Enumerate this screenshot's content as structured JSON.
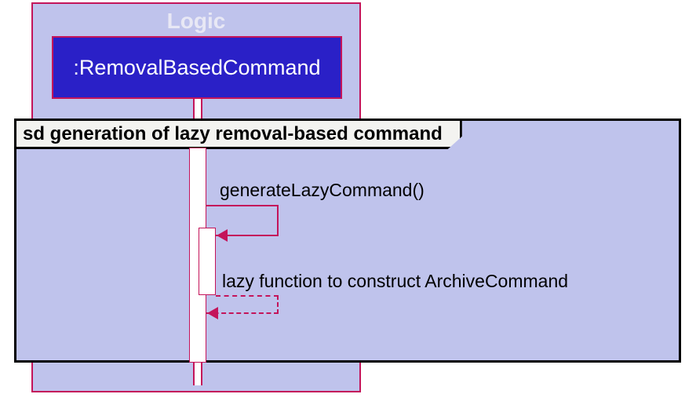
{
  "box": {
    "title": "Logic"
  },
  "participant": {
    "label": ":RemovalBasedCommand"
  },
  "frame": {
    "label": "sd generation of lazy removal-based command"
  },
  "messages": {
    "call1": "generateLazyCommand()",
    "return1": "lazy function to construct ArchiveCommand"
  }
}
